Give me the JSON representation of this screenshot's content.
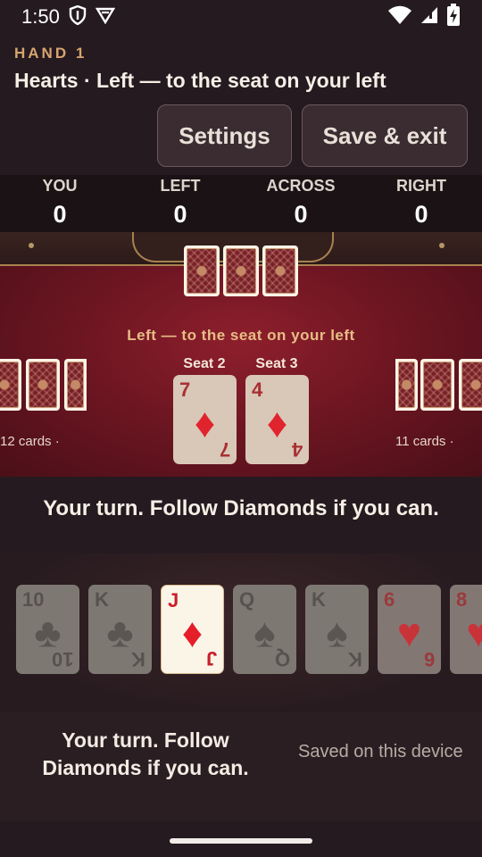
{
  "status_bar": {
    "time": "1:50"
  },
  "header": {
    "hand_label": "HAND 1",
    "subtitle": "Hearts · Left — to the seat on your left",
    "settings_label": "Settings",
    "save_exit_label": "Save & exit"
  },
  "scores": [
    {
      "label": "YOU",
      "value": "0"
    },
    {
      "label": "LEFT",
      "value": "0"
    },
    {
      "label": "ACROSS",
      "value": "0"
    },
    {
      "label": "RIGHT",
      "value": "0"
    }
  ],
  "table": {
    "pass_hint": "Left — to the seat on your left",
    "left_count": "12 cards ·",
    "right_count": "11 cards ·",
    "trick": [
      {
        "seat": "Seat 2",
        "rank": "7",
        "suit": "♦"
      },
      {
        "seat": "Seat 3",
        "rank": "4",
        "suit": "♦"
      }
    ]
  },
  "status_message": "Your turn. Follow Diamonds if you can.",
  "hand": [
    {
      "rank": "10",
      "suit": "♣",
      "state": "dim"
    },
    {
      "rank": "K",
      "suit": "♣",
      "state": "dim"
    },
    {
      "rank": "J",
      "suit": "♦",
      "state": "active"
    },
    {
      "rank": "Q",
      "suit": "♠",
      "state": "dim"
    },
    {
      "rank": "K",
      "suit": "♠",
      "state": "dim"
    },
    {
      "rank": "6",
      "suit": "♥",
      "state": "dim-red"
    },
    {
      "rank": "8",
      "suit": "♥",
      "state": "dim-red"
    }
  ],
  "footer": {
    "message": "Your turn. Follow Diamonds if you can.",
    "saved": "Saved on this device"
  },
  "colors": {
    "accent": "#d7a56f",
    "felt": "#7a1a26",
    "red_suit": "#e0242e"
  }
}
